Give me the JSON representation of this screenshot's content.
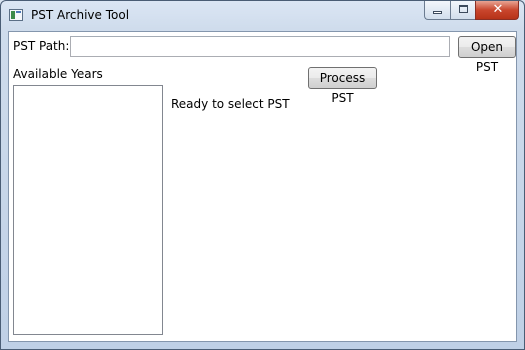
{
  "window": {
    "title": "PST Archive Tool",
    "close_glyph": "✕"
  },
  "form": {
    "pst_path_label": "PST Path:",
    "pst_path_value": "",
    "open_button": "Open PST",
    "available_years_label": "Available Years",
    "process_button": "Process PST",
    "status": "Ready to select PST"
  },
  "years": [],
  "icons": [
    "app-icon",
    "minimize-icon",
    "maximize-icon",
    "close-icon"
  ]
}
